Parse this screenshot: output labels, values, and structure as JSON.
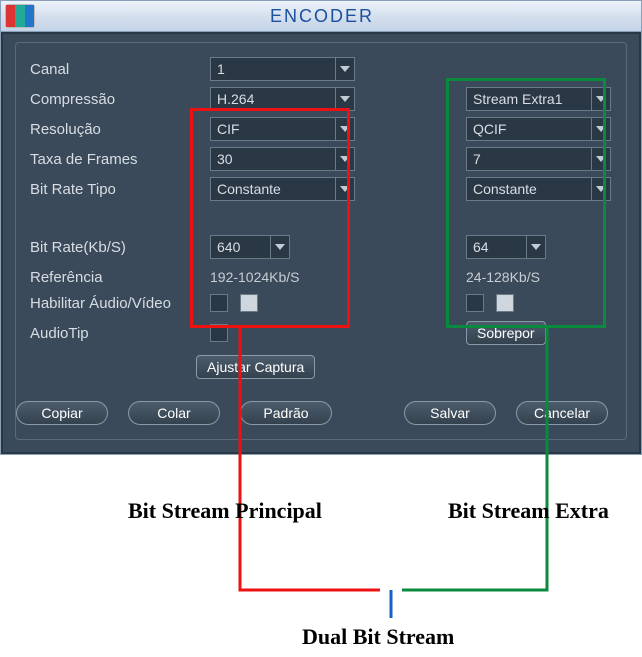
{
  "window": {
    "title": "ENCODER"
  },
  "labels": {
    "canal": "Canal",
    "compressao": "Compressão",
    "resolucao": "Resolução",
    "taxa_frames": "Taxa de Frames",
    "bitrate_tipo": "Bit Rate Tipo",
    "bitrate_kbs": "Bit Rate(Kb/S)",
    "referencia": "Referência",
    "hab_av": "Habilitar Áudio/Vídeo",
    "audiotip": "AudioTip"
  },
  "main": {
    "canal": "1",
    "compressao": "H.264",
    "resolucao": "CIF",
    "taxa_frames": "30",
    "bitrate_tipo": "Constante",
    "bitrate": "640",
    "referencia": "192-1024Kb/S",
    "chk_video": false,
    "chk_audio": true,
    "audiotip": false
  },
  "extra": {
    "stream": "Stream Extra1",
    "resolucao": "QCIF",
    "taxa_frames": "7",
    "bitrate_tipo": "Constante",
    "bitrate": "64",
    "referencia": "24-128Kb/S",
    "chk_video": false,
    "chk_audio": true
  },
  "buttons": {
    "sobrepor": "Sobrepor",
    "ajustar_captura": "Ajustar Captura",
    "copiar": "Copiar",
    "colar": "Colar",
    "padrao": "Padrão",
    "salvar": "Salvar",
    "cancelar": "Cancelar"
  },
  "annotations": {
    "principal": "Bit Stream Principal",
    "extra": "Bit Stream Extra",
    "dual": "Dual Bit Stream"
  },
  "colors": {
    "principal_border": "#e11",
    "extra_border": "#0a8a3c",
    "dual_line": "#1561c6"
  }
}
